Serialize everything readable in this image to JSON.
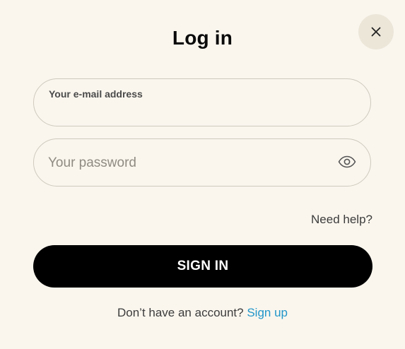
{
  "dialog": {
    "title": "Log in",
    "close_icon": "close-icon"
  },
  "email": {
    "label": "Your e-mail address",
    "value": "",
    "placeholder": ""
  },
  "password": {
    "value": "",
    "placeholder": "Your password",
    "toggle_icon": "eye-icon"
  },
  "help": {
    "label": "Need help?"
  },
  "sign_in": {
    "label": "SIGN IN"
  },
  "signup": {
    "prompt": "Don’t have an account?",
    "link_label": "Sign up",
    "link_color": "#2196c9"
  },
  "colors": {
    "background": "#faf6ee",
    "button": "#000000",
    "close_bg": "#ece6d9"
  }
}
